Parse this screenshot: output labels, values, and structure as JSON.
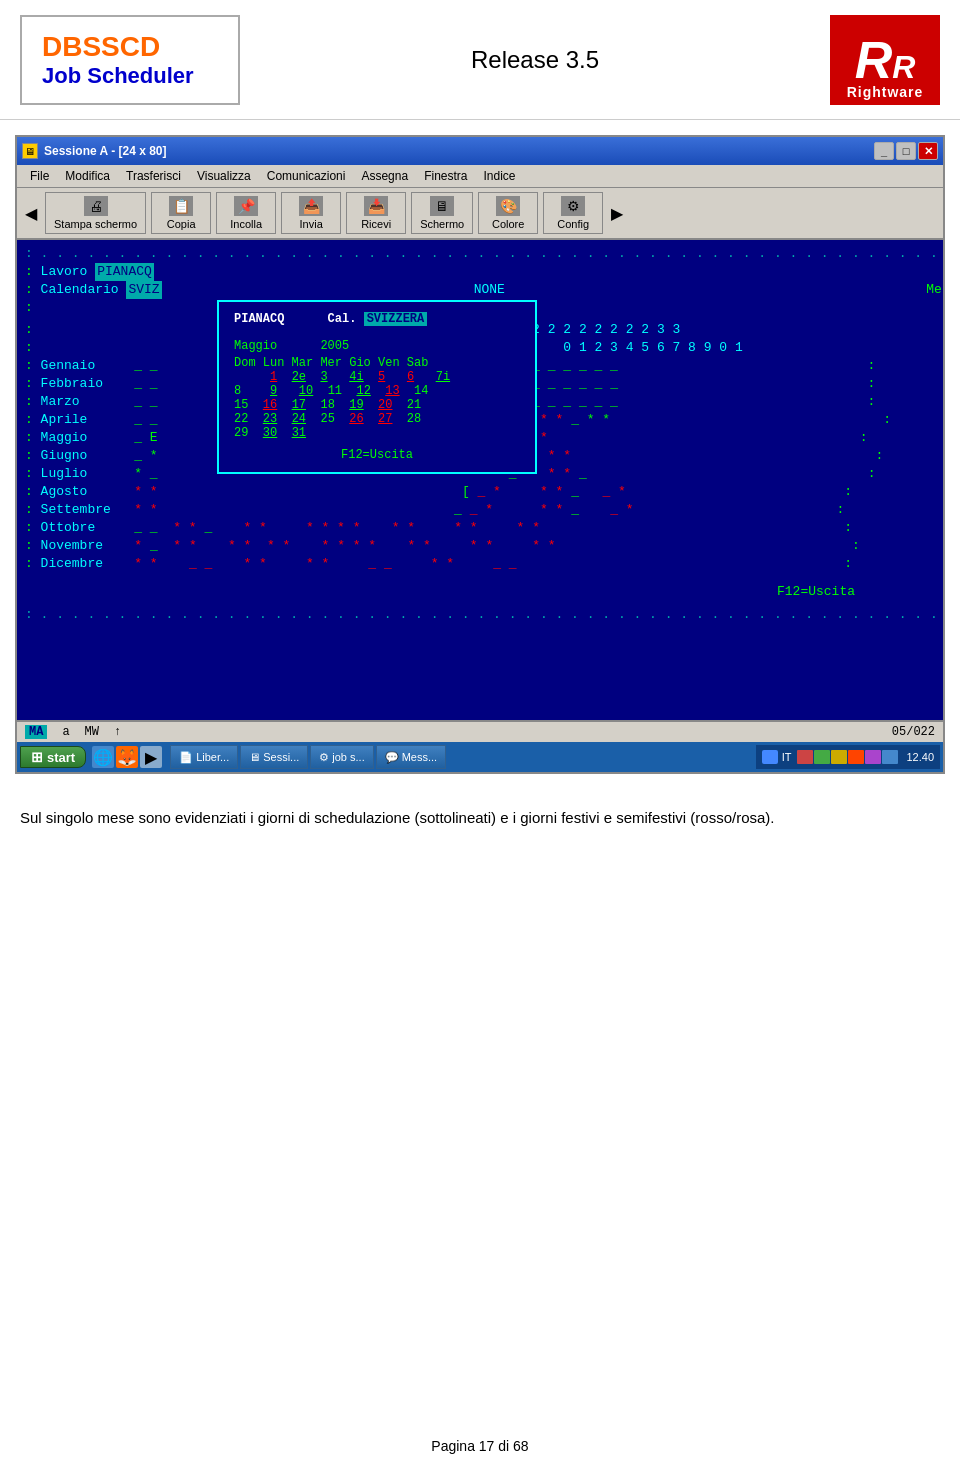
{
  "header": {
    "logo_title": "DBSSCD",
    "logo_subtitle": "Job Scheduler",
    "release": "Release 3.5",
    "brand_letters": "RR",
    "brand_name": "Rightware"
  },
  "window": {
    "title": "Sessione A - [24 x 80]",
    "menu_items": [
      "File",
      "Modifica",
      "Trasferisci",
      "Visualizza",
      "Comunicazioni",
      "Assegna",
      "Finestra",
      "Indice"
    ],
    "toolbar_btns": [
      "Stampa schermo",
      "Copia",
      "Incolla",
      "Invia",
      "Ricevi",
      "Schermo",
      "Colore",
      "Config"
    ]
  },
  "terminal": {
    "lavoro_label": "Lavoro",
    "lavoro_value": "PIANACQ",
    "calendario_label": "Calendario",
    "calendario_value": "SVIZ",
    "months": [
      {
        "name": "Gennaio",
        "v1": "_",
        "v2": "_"
      },
      {
        "name": "Febbraio",
        "v1": "_",
        "v2": "_"
      },
      {
        "name": "Marzo",
        "v1": "_",
        "v2": "_"
      },
      {
        "name": "Aprile",
        "v1": "_",
        "v2": "_"
      },
      {
        "name": "Maggio",
        "v1": "_",
        "v2": "E"
      },
      {
        "name": "Giugno",
        "v1": "_",
        "v2": "*"
      },
      {
        "name": "Luglio",
        "v1": "*",
        "v2": "_"
      },
      {
        "name": "Agosto",
        "v1": "*",
        "v2": "*"
      },
      {
        "name": "Settembre",
        "v1": "*",
        "v2": "*"
      },
      {
        "name": "Ottobre",
        "v1": "_",
        "v2": "_"
      },
      {
        "name": "Novembre",
        "v1": "*",
        "v2": "_"
      },
      {
        "name": "Dicembre",
        "v1": "*",
        "v2": "*"
      }
    ],
    "none_label": "NONE",
    "f12_label": "F12=Uscita"
  },
  "calendar_popup": {
    "title_left": "PIANACQ",
    "title_cal": "Cal.",
    "title_cal_val": "SVIZZERA",
    "month": "Maggio",
    "year": "2005",
    "days_header": "Dom Lun Mar Mer Gio Ven Sab",
    "rows": [
      "     1  2e  3   4i  5   6   7i",
      "8    9  10  11  12  13  14",
      "15  16  17  18  19  20  21",
      "22  23  24  25  26  27  28",
      "29  30  31"
    ],
    "f12": "F12=Uscita"
  },
  "statusbar": {
    "left": "MA",
    "mid1": "a",
    "mid2": "MW",
    "mid3": "↑",
    "right": "05/022"
  },
  "taskbar": {
    "start": "start",
    "buttons": [
      "Liber...",
      "Sessi...",
      "job s...",
      "Mess..."
    ],
    "lang": "IT",
    "time": "12.40"
  },
  "description": "Sul singolo mese sono evidenziati i giorni di schedulazione (sottolineati) e i giorni festivi e semifestivi (rosso/rosa).",
  "pagination": {
    "current": "17",
    "total": "68",
    "label": "Pagina 17 di 68"
  }
}
